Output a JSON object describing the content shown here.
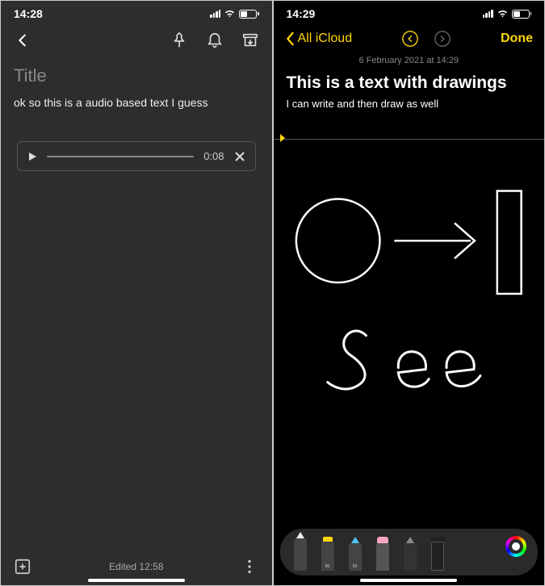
{
  "left": {
    "status": {
      "time": "14:28"
    },
    "titlePlaceholder": "Title",
    "bodyText": "ok so this is a audio based text I guess",
    "audio": {
      "duration": "0:08"
    },
    "editedLabel": "Edited 12:58"
  },
  "right": {
    "status": {
      "time": "14:29"
    },
    "backLabel": "All iCloud",
    "doneLabel": "Done",
    "dateLine": "6 February 2021 at 14:29",
    "noteTitle": "This is a text with drawings",
    "noteBody": "I can write and then draw as well",
    "handwriting": "See",
    "tools": {
      "marker": "80",
      "pencil": "50"
    }
  }
}
